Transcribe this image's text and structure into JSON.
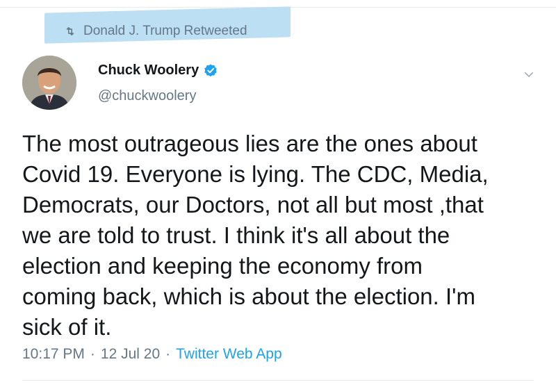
{
  "retweet": {
    "label": "Donald J. Trump Retweeted"
  },
  "author": {
    "name": "Chuck Woolery",
    "handle": "@chuckwoolery"
  },
  "tweet": {
    "text": "The most outrageous lies are the ones about\nCovid 19. Everyone is lying. The CDC, Media,\nDemocrats, our Doctors, not all but most ,that\nwe are told to trust. I think it's all about the\nelection and keeping the economy from\ncoming back, which is about the election. I'm\nsick of it."
  },
  "meta": {
    "time": "10:17 PM",
    "date": "12 Jul 20",
    "source": "Twitter Web App",
    "separator": "·"
  },
  "colors": {
    "link": "#1da1f2",
    "muted": "#657786",
    "highlight": "#bcdff3"
  },
  "icons": {
    "retweet": "retweet-icon",
    "verified": "verified-badge-icon",
    "menu": "chevron-down-icon"
  }
}
